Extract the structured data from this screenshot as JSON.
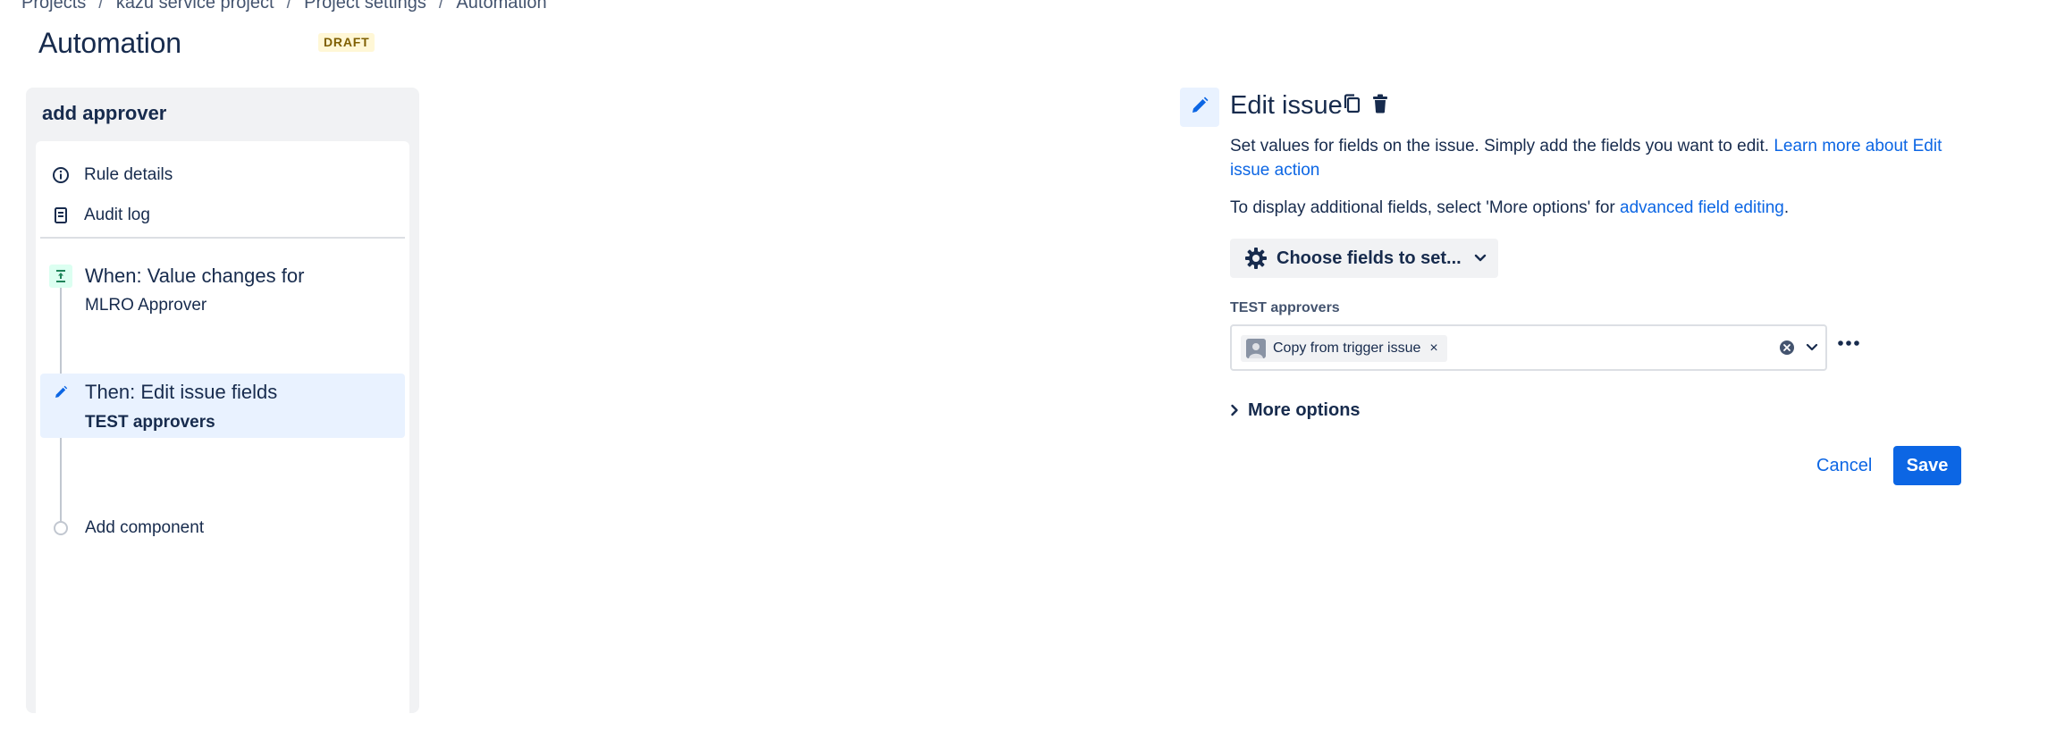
{
  "breadcrumb": {
    "items": [
      "Projects",
      "kazu service project",
      "Project settings",
      "Automation"
    ],
    "separator": "/"
  },
  "header": {
    "title": "Automation",
    "badge": "DRAFT"
  },
  "rule": {
    "name": "add approver",
    "menu": [
      {
        "label": "Rule details",
        "icon": "info-icon"
      },
      {
        "label": "Audit log",
        "icon": "audit-log-icon"
      }
    ],
    "steps": [
      {
        "title": "When: Value changes for",
        "subtitle": "MLRO Approver",
        "icon": "trigger-icon"
      },
      {
        "title": "Then: Edit issue fields",
        "subtitle": "TEST approvers",
        "icon": "pencil-icon",
        "selected": true
      }
    ],
    "add_component": "Add component"
  },
  "editor": {
    "title": "Edit issue",
    "icon": "pencil-icon",
    "actions": [
      "copy-icon",
      "trash-icon"
    ],
    "desc1_text": "Set values for fields on the issue. Simply add the fields you want to edit. ",
    "desc1_link": "Learn more about Edit issue action",
    "desc2_text": "To display additional fields, select 'More options' for ",
    "desc2_link": "advanced field editing",
    "desc2_end": ".",
    "choose_fields": "Choose fields to set...",
    "field": {
      "label": "TEST approvers",
      "tag": "Copy from trigger issue",
      "tag_remove": "×"
    },
    "more_options": "More options",
    "cancel": "Cancel",
    "save": "Save"
  },
  "colors": {
    "primary": "#0c66e4",
    "text": "#172b4d",
    "subtle": "#44546f",
    "panel": "#f1f2f4",
    "selected": "#e9f2ff",
    "badge_bg": "#fff7d6",
    "badge_text": "#7f5f01",
    "trigger_bg": "#dcfff1",
    "trigger_fg": "#1f845a"
  }
}
